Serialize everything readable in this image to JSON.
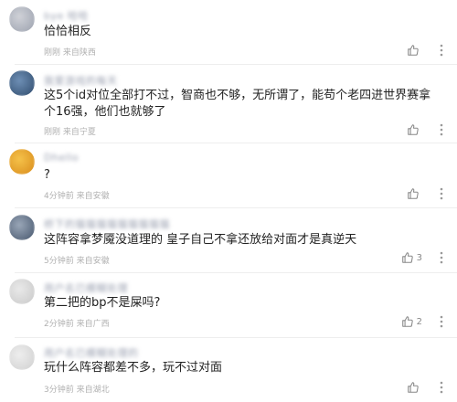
{
  "comments": [
    {
      "username": "bye 哈哈",
      "text": "恰恰相反",
      "meta": "刚刚 来自陕西",
      "likes": "",
      "avatar_colors": [
        "#d0d2d8",
        "#9aa0ad"
      ]
    },
    {
      "username": "我爱游戏的每天",
      "text": "这5个id对位全部打不过，智商也不够，无所谓了，能苟个老四进世界赛拿个16强，他们也就够了",
      "meta": "刚刚 来自宁夏",
      "likes": "",
      "avatar_colors": [
        "#6e8fb5",
        "#2e4a6b"
      ]
    },
    {
      "username": "Dhello",
      "text": "?",
      "meta": "4分钟前 来自安徽",
      "likes": "",
      "avatar_colors": [
        "#f5c24a",
        "#d88a1a"
      ]
    },
    {
      "username": "桥下的猫猫猫猫猫猫猫猫猫",
      "text": "这阵容拿梦魇没道理的 皇子自己不拿还放给对面才是真逆天",
      "meta": "5分钟前 来自安徽",
      "likes": "3",
      "avatar_colors": [
        "#9aa7b8",
        "#44546b"
      ]
    },
    {
      "username": "用户名已模糊处理",
      "text": "第二把的bp不是屎吗?",
      "meta": "2分钟前 来自广西",
      "likes": "2",
      "avatar_colors": [
        "#e9e9e9",
        "#c8c8c8"
      ]
    },
    {
      "username": "用户名已模糊处理的",
      "text": "玩什么阵容都差不多，玩不过对面",
      "meta": "3分钟前 来自湖北",
      "likes": "",
      "avatar_colors": [
        "#eeeeee",
        "#cfcfcf"
      ]
    }
  ],
  "icons": {
    "like": "thumbs-up-icon",
    "more": "more-vertical-icon"
  }
}
